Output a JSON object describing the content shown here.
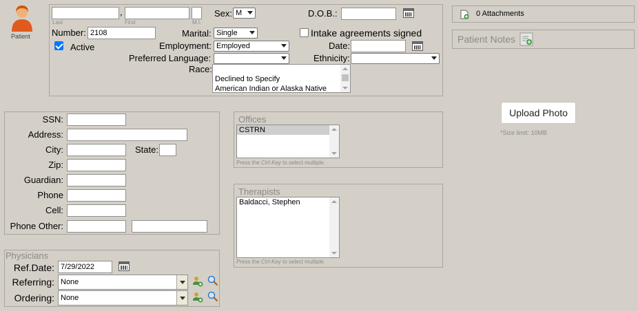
{
  "patient": {
    "label": "Patient",
    "icon": "patient-avatar-icon"
  },
  "name": {
    "last": "",
    "first": "",
    "mi": "",
    "last_hint": "Last",
    "first_hint": "First",
    "mi_hint": "M.I.",
    "comma": ","
  },
  "number": {
    "label": "Number:",
    "value": "2108"
  },
  "active": {
    "label": "Active",
    "checked": true
  },
  "sex": {
    "label": "Sex:",
    "value": "M"
  },
  "dob": {
    "label": "D.O.B.:",
    "value": ""
  },
  "marital": {
    "label": "Marital:",
    "value": "Single"
  },
  "intake": {
    "label": "Intake agreements signed",
    "checked": false
  },
  "employment": {
    "label": "Employment:",
    "value": "Employed"
  },
  "date": {
    "label": "Date:",
    "value": ""
  },
  "preferred_language": {
    "label": "Preferred Language:",
    "value": ""
  },
  "ethnicity": {
    "label": "Ethnicity:",
    "value": ""
  },
  "race": {
    "label": "Race:",
    "options": [
      "",
      "Declined to Specify",
      "American Indian or Alaska Native"
    ]
  },
  "attachments": {
    "label": "0 Attachments"
  },
  "patient_notes": {
    "label": "Patient Notes"
  },
  "upload": {
    "label": "Upload Photo",
    "hint": "*Size limit: 10MB"
  },
  "contact": {
    "ssn": "SSN:",
    "address": "Address:",
    "city": "City:",
    "state": "State:",
    "zip": "Zip:",
    "guardian": "Guardian:",
    "phone": "Phone",
    "cell": "Cell:",
    "phone_other": "Phone Other:"
  },
  "offices": {
    "legend": "Offices",
    "items": [
      "CSTRN"
    ],
    "hint_pre": "Press the ",
    "hint_key": "Ctrl-Key",
    "hint_post": " to select multiple."
  },
  "therapists": {
    "legend": "Therapists",
    "items": [
      "Baldacci, Stephen"
    ],
    "hint_pre": "Press the ",
    "hint_key": "Ctrl-Key",
    "hint_post": " to select multiple."
  },
  "physicians": {
    "legend": "Physicians",
    "ref_date_label": "Ref.Date:",
    "ref_date_value": "7/29/2022",
    "referring_label": "Referring:",
    "referring_value": "None",
    "ordering_label": "Ordering:",
    "ordering_value": "None"
  },
  "colors": {
    "checkbox_accent": "#0075ff",
    "background": "#d4d0c8"
  }
}
